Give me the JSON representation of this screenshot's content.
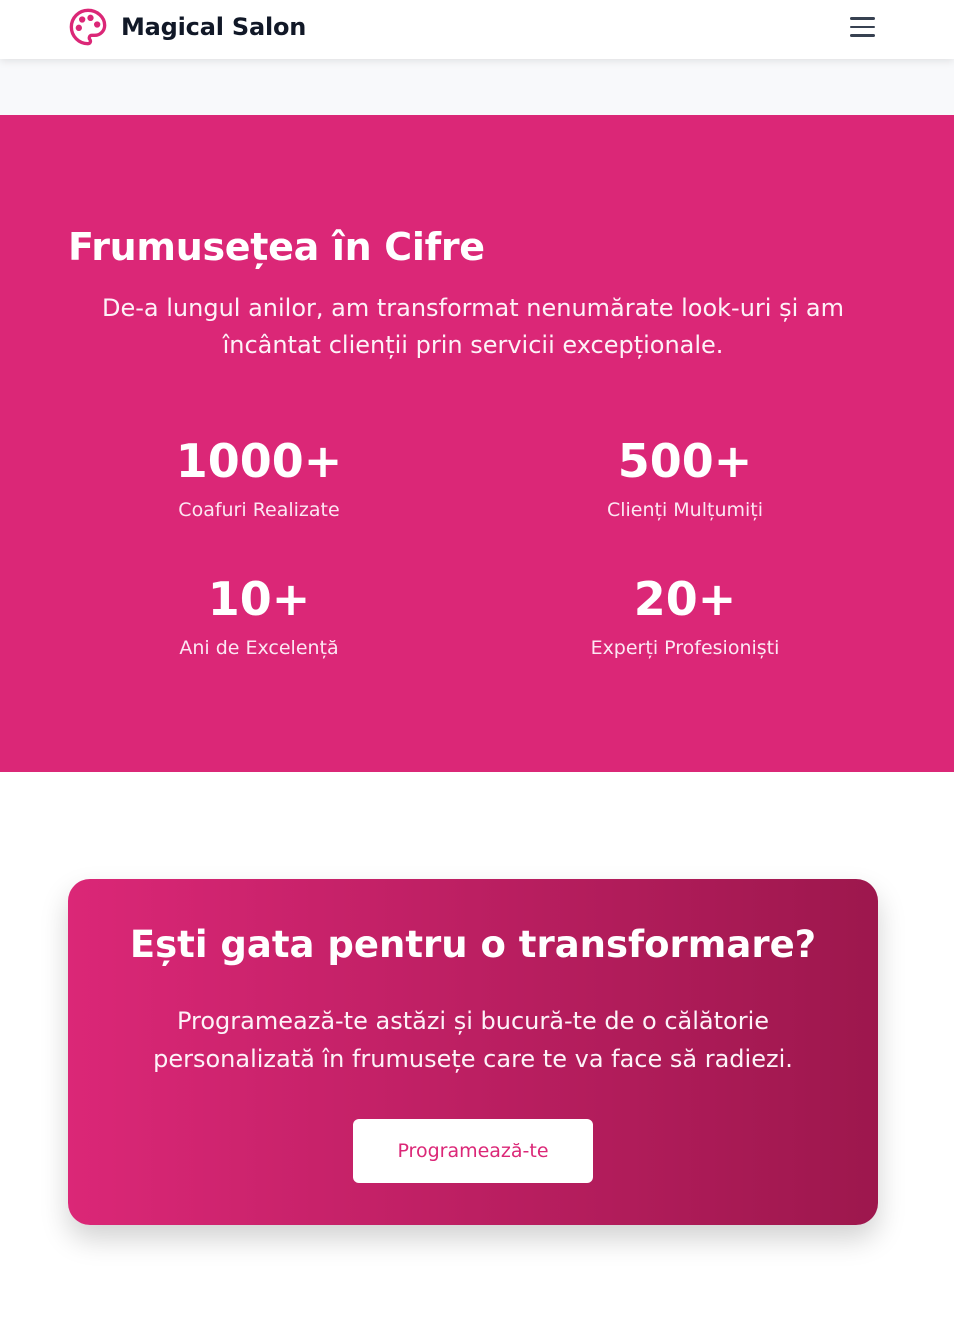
{
  "header": {
    "logo_icon": "palette-icon",
    "brand_name": "Magical Salon",
    "menu_icon": "hamburger-menu-icon"
  },
  "colors": {
    "brand_pink": "#db2777",
    "brand_pink_dark": "#9d174d",
    "text_dark": "#111827"
  },
  "stats": {
    "title": "Frumusețea în Cifre",
    "description": "De-a lungul anilor, am transformat nenumărate look-uri și am încântat clienții prin servicii excepționale.",
    "items": [
      {
        "number": "1000+",
        "label": "Coafuri Realizate"
      },
      {
        "number": "500+",
        "label": "Clienți Mulțumiți"
      },
      {
        "number": "10+",
        "label": "Ani de Excelență"
      },
      {
        "number": "20+",
        "label": "Experți Profesioniști"
      }
    ]
  },
  "cta": {
    "title": "Ești gata pentru o transformare?",
    "description": "Programează-te astăzi și bucură-te de o călătorie personalizată în frumusețe care te va face să radiezi.",
    "button_label": "Programează-te"
  }
}
